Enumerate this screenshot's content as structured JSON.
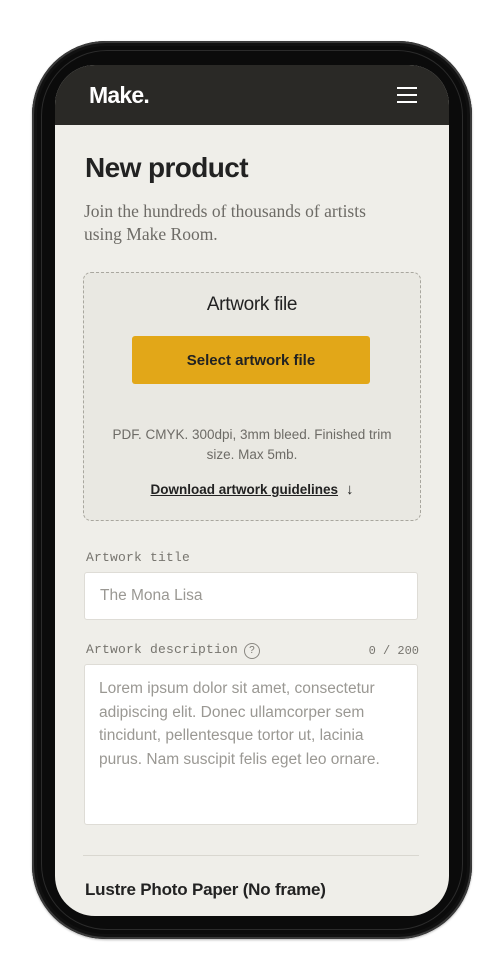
{
  "header": {
    "logo": "Make.",
    "menu_icon": "hamburger-menu-icon"
  },
  "page": {
    "title": "New product",
    "subtitle": "Join the hundreds of thousands of artists using Make Room."
  },
  "artwork_upload": {
    "title": "Artwork file",
    "button_label": "Select artwork file",
    "hint": "PDF. CMYK. 300dpi, 3mm bleed. Finished trim size. Max 5mb.",
    "guidelines_link": "Download artwork guidelines",
    "guidelines_icon": "arrow-down-icon"
  },
  "form": {
    "title_label": "Artwork title",
    "title_placeholder": "The Mona Lisa",
    "description_label": "Artwork description",
    "description_help_icon": "?",
    "description_counter": "0 / 200",
    "description_placeholder": "Lorem ipsum dolor sit amet, consectetur adipiscing elit. Donec ullamcorper sem tincidunt, pellentesque tortor ut, lacinia purus. Nam suscipit felis eget leo ornare."
  },
  "product": {
    "section_title": "Lustre Photo Paper (No frame)"
  },
  "colors": {
    "header_bg": "#2a2926",
    "page_bg": "#efeee9",
    "accent": "#e2a718",
    "device_frame": "#0b0b0b"
  }
}
